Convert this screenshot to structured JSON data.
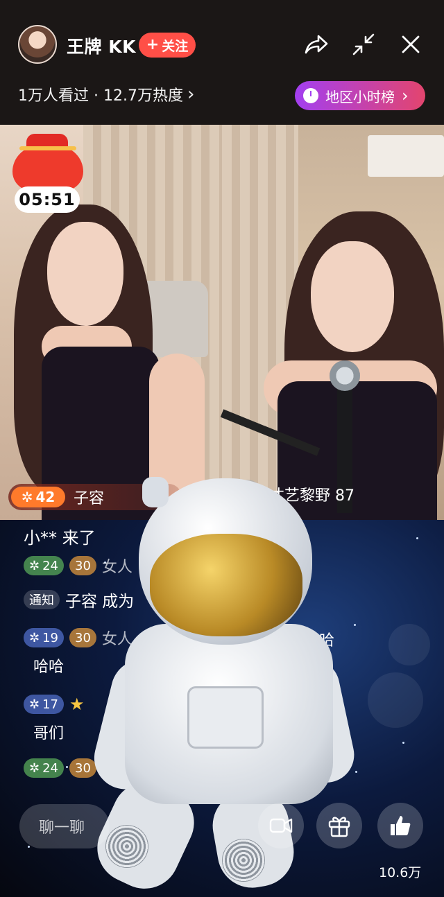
{
  "header": {
    "anchor_name": "王牌 KK",
    "follow_label": "关注",
    "stats": "1万人看过 · 12.7万热度",
    "rank_label": "地区小时榜"
  },
  "icons": {
    "share": "share-icon",
    "minimize": "minimize-icon",
    "close": "close-icon",
    "gift": "gift-icon",
    "like": "thumbs-up-icon",
    "video_call": "video-call-icon"
  },
  "video": {
    "timer": "05:51",
    "left_guest": {
      "level": "42",
      "name": "子容"
    },
    "right_guest": {
      "name": "才艺黎野 87"
    }
  },
  "chat": {
    "entry_message": "小** 来了",
    "rows": [
      {
        "level": "24",
        "fan_level": "30",
        "text": "女人"
      },
      {
        "tag": "通知",
        "text": "子容 成为"
      },
      {
        "level": "19",
        "fan_level": "30",
        "text": "女人",
        "extra": "哈哈",
        "sub": "哈哈"
      },
      {
        "level": "17",
        "sub": "哥们"
      },
      {
        "level": "24",
        "fan_level": "30"
      }
    ]
  },
  "bottom": {
    "chat_placeholder": "聊一聊",
    "like_count": "10.6万"
  },
  "colors": {
    "follow": "#ff4f47",
    "rank_gradient_start": "#a33ff0",
    "rank_gradient_end": "#e3456e",
    "level_orange": "#ff7a2b"
  }
}
